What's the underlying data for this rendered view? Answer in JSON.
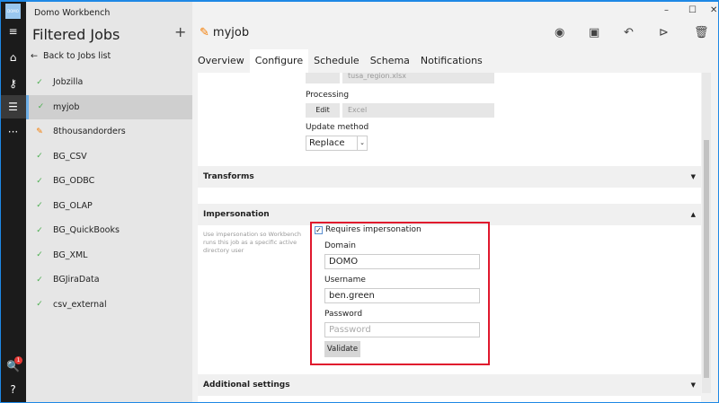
{
  "app": {
    "title": "Domo Workbench",
    "logo": "DOMO"
  },
  "rail": {
    "badge_count": "1"
  },
  "sidebar": {
    "title": "Filtered Jobs",
    "add": "+",
    "back": "Back to Jobs list",
    "jobs": [
      {
        "name": "Jobzilla",
        "status": "ok"
      },
      {
        "name": "myjob",
        "status": "ok"
      },
      {
        "name": "8thousandorders",
        "status": "edited"
      },
      {
        "name": "BG_CSV",
        "status": "ok"
      },
      {
        "name": "BG_ODBC",
        "status": "ok"
      },
      {
        "name": "BG_OLAP",
        "status": "ok"
      },
      {
        "name": "BG_QuickBooks",
        "status": "ok"
      },
      {
        "name": "BG_XML",
        "status": "ok"
      },
      {
        "name": "BGJiraData",
        "status": "ok"
      },
      {
        "name": "csv_external",
        "status": "ok"
      }
    ]
  },
  "header": {
    "job": "myjob"
  },
  "tabs": [
    "Overview",
    "Configure",
    "Schedule",
    "Schema",
    "Notifications"
  ],
  "config": {
    "file": "tusa_region.xlsx",
    "processing_label": "Processing",
    "edit": "Edit",
    "processing_value": "Excel",
    "update_label": "Update method",
    "update_value": "Replace"
  },
  "sections": {
    "transforms": "Transforms",
    "impersonation": "Impersonation",
    "additional": "Additional settings"
  },
  "impersonation": {
    "help": "Use impersonation so Workbench runs this job as a specific active directory user",
    "requires": "Requires impersonation",
    "checked": true,
    "domain_label": "Domain",
    "domain": "DOMO",
    "username_label": "Username",
    "username": "ben.green",
    "password_label": "Password",
    "password_placeholder": "Password",
    "validate": "Validate"
  }
}
